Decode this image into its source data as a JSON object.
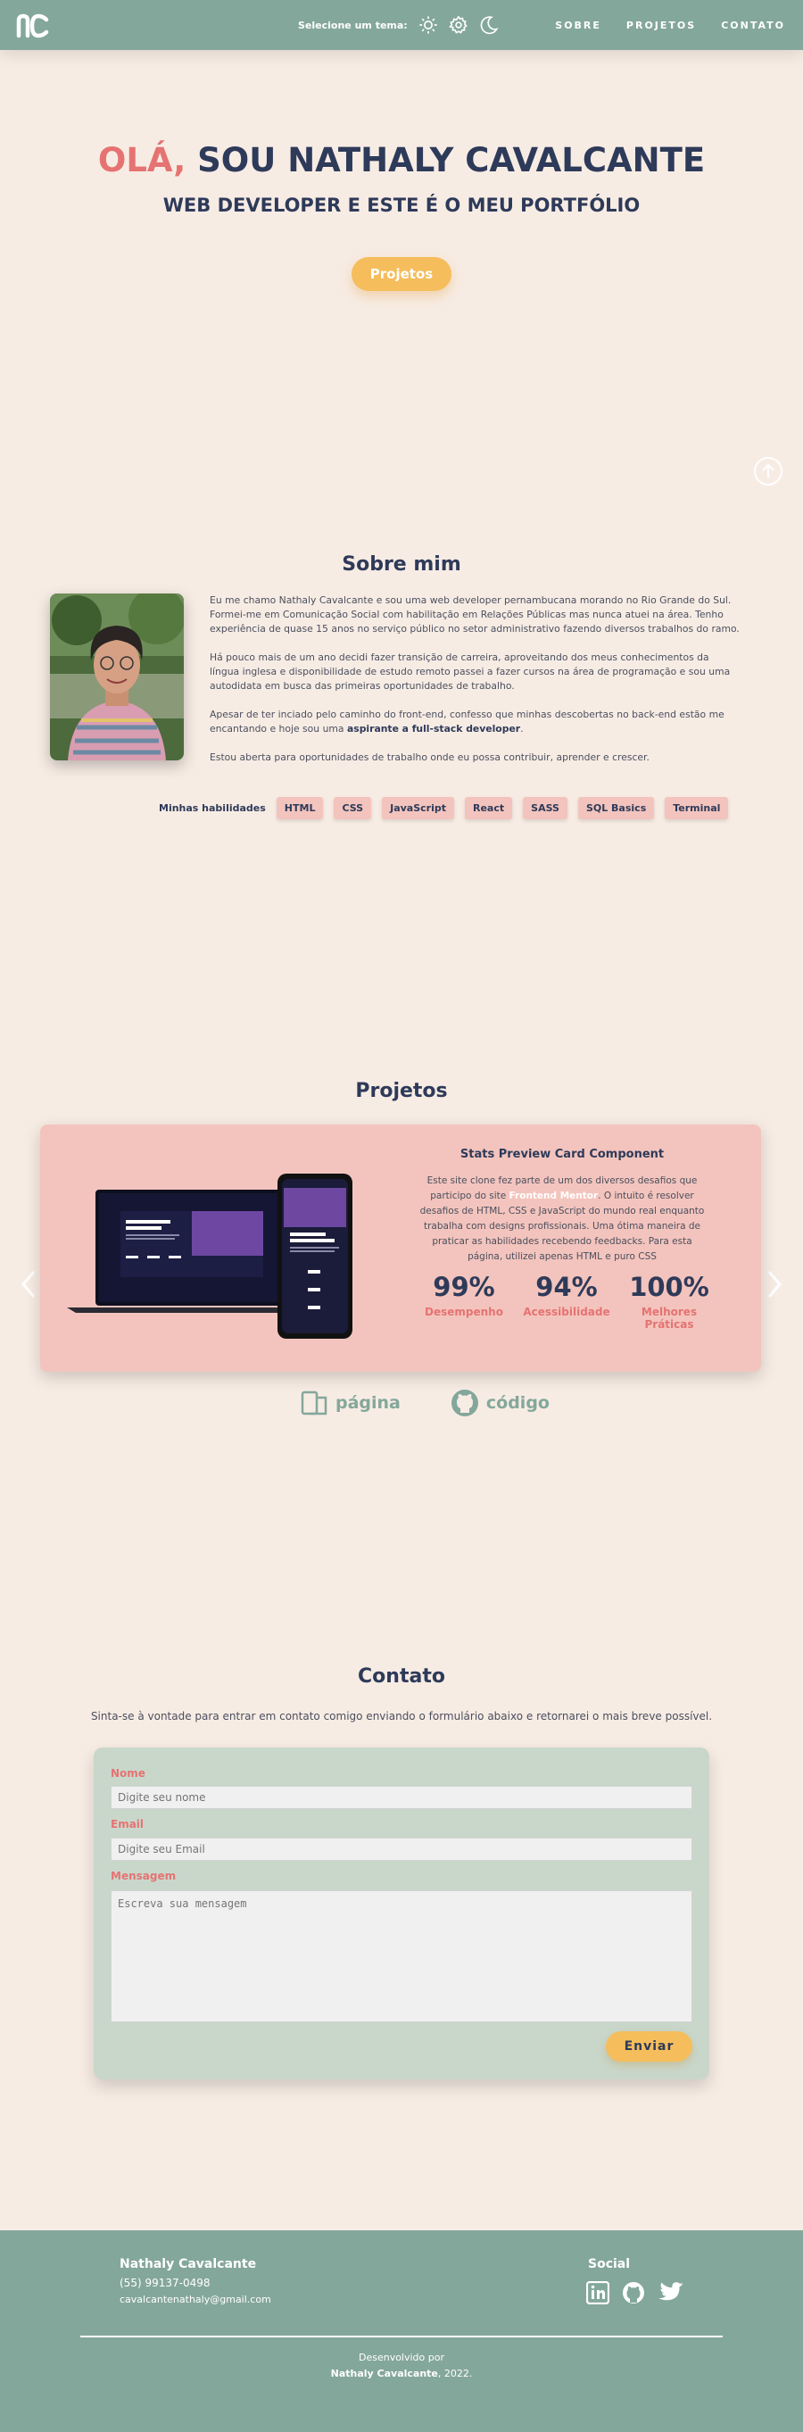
{
  "header": {
    "logo_text": "nc",
    "theme_label": "Selecione um tema:",
    "nav": [
      "SOBRE",
      "PROJETOS",
      "CONTATO"
    ],
    "icons": [
      "sun-icon",
      "gear-icon",
      "moon-icon"
    ]
  },
  "hero": {
    "greeting": "OLÁ,",
    "title_rest": " SOU NATHALY CAVALCANTE",
    "subtitle": "WEB DEVELOPER E ESTE É O MEU PORTFÓLIO",
    "button": "Projetos"
  },
  "about": {
    "title": "Sobre mim",
    "p1": "Eu me chamo Nathaly Cavalcante e sou uma web developer pernambucana morando no Rio Grande do Sul. Formei-me em Comunicação Social com habilitação em Relações Públicas mas nunca atuei na área. Tenho experiência de quase 15 anos no serviço público no setor administrativo fazendo diversos trabalhos do ramo.",
    "p2": "Há pouco mais de um ano decidi fazer transição de carreira, aproveitando dos meus conhecimentos da língua inglesa e disponibilidade de estudo remoto passei a fazer cursos na área de programação e sou uma autodidata em busca das primeiras oportunidades de trabalho.",
    "p3_start": "Apesar de ter inciado pelo caminho do front-end, confesso que minhas descobertas no back-end estão me encantando e hoje sou uma ",
    "p3_bold": "aspirante a full-stack developer",
    "p3_end": ".",
    "p4": "Estou aberta para oportunidades de trabalho onde eu possa contribuir, aprender e crescer.",
    "skills_label": "Minhas habilidades",
    "skills": [
      "HTML",
      "CSS",
      "JavaScript",
      "React",
      "SASS",
      "SQL Basics",
      "Terminal"
    ]
  },
  "projects": {
    "title": "Projetos",
    "card_title": "Stats Preview Card Component",
    "desc_start": "Este site clone fez parte de um dos diversos desafios que participo do site ",
    "desc_link": "Frontend Mentor",
    "desc_end": ". O intuito é resolver desafios de HTML, CSS e JavaScript do mundo real enquanto trabalha com designs profissionais. Uma ótima maneira de praticar as habilidades recebendo feedbacks. Para esta página, utilizei apenas HTML e puro CSS",
    "scores": [
      {
        "value": "99%",
        "label": "Desempenho"
      },
      {
        "value": "94%",
        "label": "Acessibilidade"
      },
      {
        "value": "100%",
        "label": "Melhores Práticas"
      }
    ],
    "links": {
      "page": "página",
      "code": "código"
    }
  },
  "contact": {
    "title": "Contato",
    "subtitle": "Sinta-se à vontade para entrar em contato comigo enviando o formulário abaixo e retornarei o mais breve possível.",
    "name_label": "Nome",
    "name_placeholder": "Digite seu nome",
    "email_label": "Email",
    "email_placeholder": "Digite seu Email",
    "message_label": "Mensagem",
    "message_placeholder": "Escreva sua mensagem",
    "send": "Enviar"
  },
  "footer": {
    "name": "Nathaly Cavalcante",
    "phone": "(55) 99137-0498",
    "email": "cavalcantenathaly@gmail.com",
    "social_title": "Social",
    "social_icons": [
      "linkedin-icon",
      "github-icon",
      "twitter-icon"
    ],
    "dev_label": "Desenvolvido por",
    "credit_name": "Nathaly Cavalcante",
    "credit_year": ", 2022."
  },
  "colors": {
    "background": "#f7ece4",
    "header": "#84a79b",
    "accent": "#e57372",
    "button": "#f5bd5c",
    "card": "#f3c4bd",
    "form": "#c9d7cb",
    "text": "#2e3a59"
  }
}
